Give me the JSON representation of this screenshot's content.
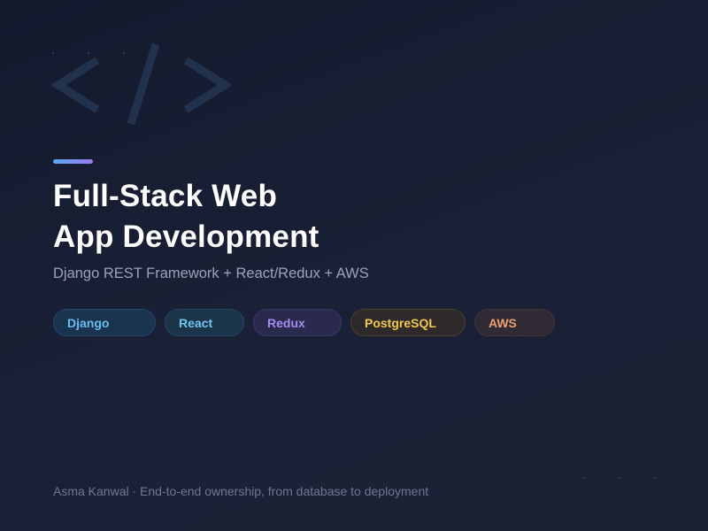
{
  "slide": {
    "title_line1": "Full-Stack Web",
    "title_line2": "App Development",
    "subtitle": "Django REST Framework + React/Redux + AWS",
    "footer": "Asma Kanwal · End-to-end ownership, from database to deployment"
  },
  "decor": {
    "code_icon": "code-brackets-icon",
    "accent_gradient": [
      "#5aa8f0",
      "#9a7cf0"
    ]
  },
  "tags": [
    {
      "label": "Django",
      "color": "#6bbdf0"
    },
    {
      "label": "React",
      "color": "#6fc8ec"
    },
    {
      "label": "Redux",
      "color": "#a98cf0"
    },
    {
      "label": "PostgreSQL",
      "color": "#f2c94c"
    },
    {
      "label": "AWS",
      "color": "#f0a070"
    }
  ]
}
